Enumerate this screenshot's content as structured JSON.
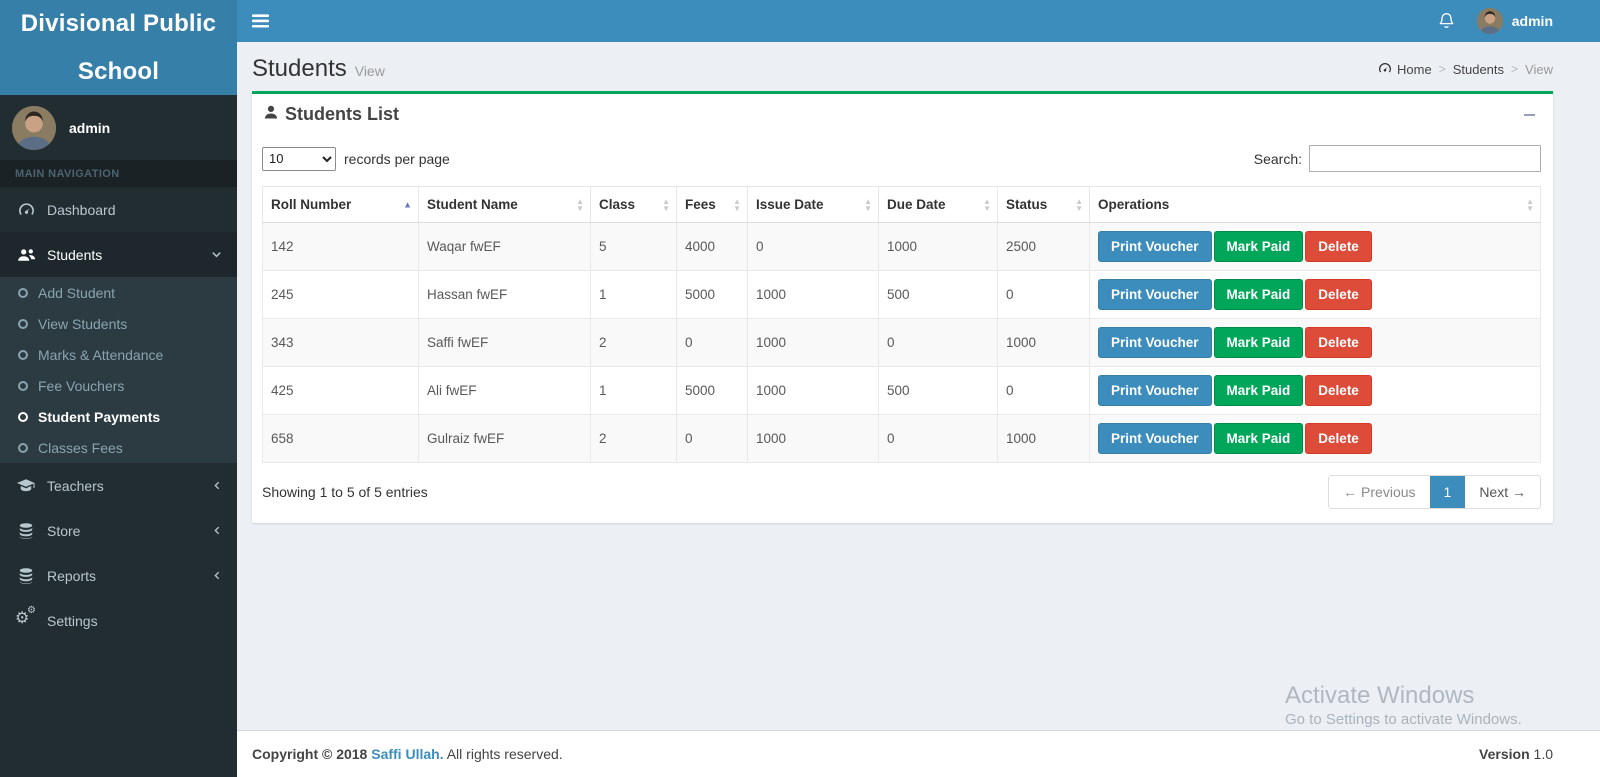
{
  "app": {
    "title_line1": "Divisional Public",
    "title_line2": "School"
  },
  "navbar": {
    "username": "admin"
  },
  "sidebar": {
    "user_name": "admin",
    "section_header": "MAIN NAVIGATION",
    "items": [
      {
        "label": "Dashboard"
      },
      {
        "label": "Students"
      },
      {
        "label": "Teachers"
      },
      {
        "label": "Store"
      },
      {
        "label": "Reports"
      },
      {
        "label": "Settings"
      }
    ],
    "students_submenu": [
      {
        "label": "Add Student"
      },
      {
        "label": "View Students"
      },
      {
        "label": "Marks & Attendance"
      },
      {
        "label": "Fee Vouchers"
      },
      {
        "label": "Student Payments"
      },
      {
        "label": "Classes Fees"
      }
    ]
  },
  "page_header": {
    "title": "Students",
    "subtitle": "View",
    "separator": ">",
    "breadcrumb": [
      "Home",
      "Students",
      "View"
    ]
  },
  "panel": {
    "title": "Students List"
  },
  "toolbar": {
    "page_length": "10",
    "records_label": "records per page",
    "search_label": "Search:",
    "search_value": ""
  },
  "table": {
    "columns": [
      "Roll Number",
      "Student Name",
      "Class",
      "Fees",
      "Issue Date",
      "Due Date",
      "Status",
      "Operations"
    ],
    "rows": [
      {
        "roll": "142",
        "name": "Waqar fwEF",
        "class": "5",
        "fees": "4000",
        "issue": "0",
        "due": "1000",
        "status": "2500"
      },
      {
        "roll": "245",
        "name": "Hassan fwEF",
        "class": "1",
        "fees": "5000",
        "issue": "1000",
        "due": "500",
        "status": "0"
      },
      {
        "roll": "343",
        "name": "Saffi fwEF",
        "class": "2",
        "fees": "0",
        "issue": "1000",
        "due": "0",
        "status": "1000"
      },
      {
        "roll": "425",
        "name": "Ali fwEF",
        "class": "1",
        "fees": "5000",
        "issue": "1000",
        "due": "500",
        "status": "0"
      },
      {
        "roll": "658",
        "name": "Gulraiz fwEF",
        "class": "2",
        "fees": "0",
        "issue": "1000",
        "due": "0",
        "status": "1000"
      }
    ],
    "actions": {
      "print": "Print Voucher",
      "mark_paid": "Mark Paid",
      "delete": "Delete"
    }
  },
  "pagination": {
    "info": "Showing 1 to 5 of 5 entries",
    "previous": "← Previous",
    "page": "1",
    "next": "Next →"
  },
  "footer": {
    "copyright_prefix": "Copyright © 2018",
    "author": "Saffi Ullah.",
    "copyright_suffix": "All rights reserved.",
    "version_label": "Version",
    "version_value": "1.0"
  },
  "watermark": {
    "line1": "Activate Windows",
    "line2": "Go to Settings to activate Windows."
  },
  "colors": {
    "navbar_blue": "#3c8dbc",
    "logo_blue": "#367fa9",
    "sidebar_dark": "#222d32",
    "success_green": "#00a65a",
    "danger_red": "#dd4b39"
  }
}
